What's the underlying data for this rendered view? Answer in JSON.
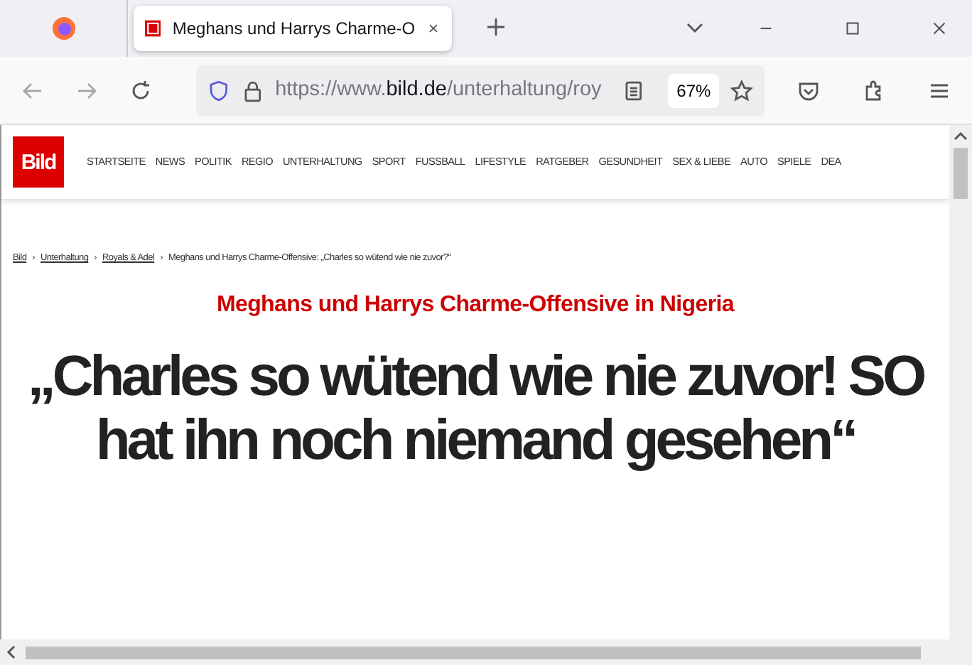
{
  "browser": {
    "tab": {
      "title": "Meghans und Harrys Charme-O",
      "selected": true
    },
    "url": {
      "scheme": "https://www.",
      "domain": "bild.de",
      "path": "/unterhaltung/roy"
    },
    "zoom": "67%"
  },
  "site": {
    "logo": "Bild",
    "nav": [
      "STARTSEITE",
      "NEWS",
      "POLITIK",
      "REGIO",
      "UNTERHALTUNG",
      "SPORT",
      "FUSSBALL",
      "LIFESTYLE",
      "RATGEBER",
      "GESUNDHEIT",
      "SEX & LIEBE",
      "AUTO",
      "SPIELE",
      "DEA"
    ]
  },
  "breadcrumb_separator": "›",
  "breadcrumb": [
    {
      "label": "Bild",
      "kind": "link"
    },
    {
      "label": "Unterhaltung",
      "kind": "link"
    },
    {
      "label": "Royals & Adel",
      "kind": "link"
    },
    {
      "label": "Meghans und Harrys Charme-Offensive: „Charles so wütend wie nie zuvor?“",
      "kind": "current"
    }
  ],
  "article": {
    "kicker": "Meghans und Harrys Charme-Offensive in Nigeria",
    "headline": "„Charles so wütend wie nie zuvor! SO hat ihn noch niemand gesehen“"
  }
}
